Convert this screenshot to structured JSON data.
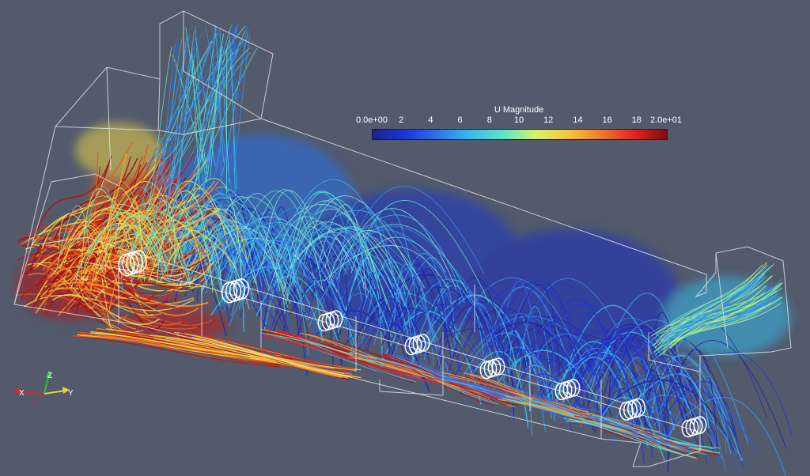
{
  "colorbar": {
    "title": "U Magnitude",
    "min": 0,
    "max": 20,
    "ticks": [
      "0.0e+00",
      "2",
      "4",
      "6",
      "8",
      "10",
      "12",
      "14",
      "16",
      "18",
      "2.0e+01"
    ],
    "colors": [
      "#1f1f8c",
      "#1a37d6",
      "#2f73ea",
      "#36bdee",
      "#5fe5c9",
      "#d8f06a",
      "#f6c53e",
      "#ef7a2a",
      "#e2231d",
      "#7f0c0c"
    ]
  },
  "axes": {
    "x": "X",
    "y": "Y",
    "z": "Z"
  },
  "background": "#525a6c",
  "wireframe_color": "#e8e8ee"
}
